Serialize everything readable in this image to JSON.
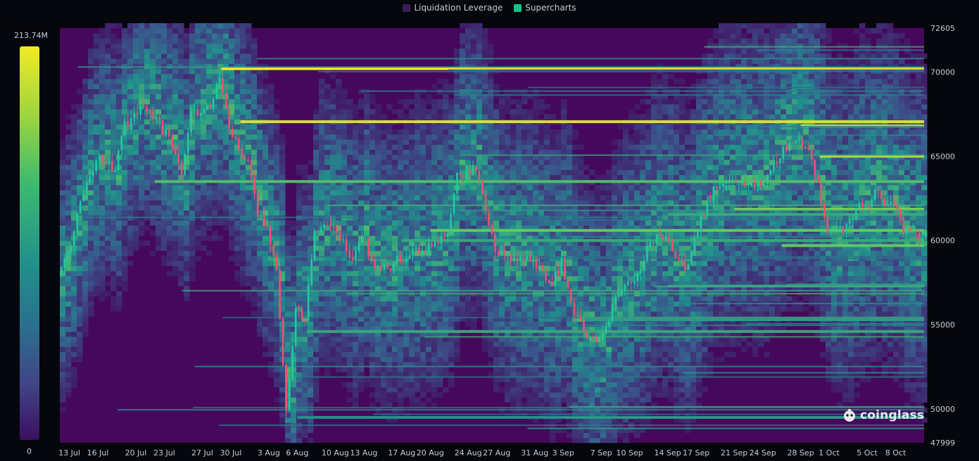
{
  "legend": {
    "items": [
      {
        "label": "Liquidation Leverage",
        "color": "#3a1c5a"
      },
      {
        "label": "Supercharts",
        "color": "#13c48a"
      }
    ]
  },
  "color_scale": {
    "max_label": "213.74M",
    "min_label": "0"
  },
  "watermark": {
    "text": "coinglass"
  },
  "chart_data": {
    "type": "heatmap",
    "title": "",
    "xlabel": "",
    "ylabel": "",
    "x_ticks": [
      "13 Jul",
      "16 Jul",
      "20 Jul",
      "23 Jul",
      "27 Jul",
      "30 Jul",
      "3 Aug",
      "6 Aug",
      "10 Aug",
      "13 Aug",
      "17 Aug",
      "20 Aug",
      "24 Aug",
      "27 Aug",
      "31 Aug",
      "3 Sep",
      "7 Sep",
      "10 Sep",
      "14 Sep",
      "17 Sep",
      "21 Sep",
      "24 Sep",
      "28 Sep",
      "1 Oct",
      "5 Oct",
      "8 Oct"
    ],
    "y_ticks": [
      72605,
      70000,
      65000,
      60000,
      55000,
      50000,
      47999
    ],
    "ylim": [
      47999,
      72605
    ],
    "xlim": [
      "12 Jul",
      "11 Oct"
    ],
    "color_range": [
      0,
      213740000
    ],
    "series_names": [
      "Liquidation Leverage",
      "Supercharts"
    ],
    "price_path": [
      [
        "12 Jul",
        57900
      ],
      [
        "13 Jul",
        59200
      ],
      [
        "15 Jul",
        63500
      ],
      [
        "16 Jul",
        64800
      ],
      [
        "18 Jul",
        64200
      ],
      [
        "19 Jul",
        66800
      ],
      [
        "21 Jul",
        68200
      ],
      [
        "22 Jul",
        67300
      ],
      [
        "24 Jul",
        65800
      ],
      [
        "25 Jul",
        64000
      ],
      [
        "26 Jul",
        67500
      ],
      [
        "28 Jul",
        68200
      ],
      [
        "29 Jul",
        69500
      ],
      [
        "30 Jul",
        66800
      ],
      [
        "31 Jul",
        65400
      ],
      [
        "1 Aug",
        64600
      ],
      [
        "2 Aug",
        61800
      ],
      [
        "3 Aug",
        60500
      ],
      [
        "4 Aug",
        58300
      ],
      [
        "5 Aug",
        50200
      ],
      [
        "6 Aug",
        56000
      ],
      [
        "7 Aug",
        55400
      ],
      [
        "8 Aug",
        60900
      ],
      [
        "9 Aug",
        60700
      ],
      [
        "10 Aug",
        60800
      ],
      [
        "12 Aug",
        58800
      ],
      [
        "13 Aug",
        60500
      ],
      [
        "14 Aug",
        58700
      ],
      [
        "16 Aug",
        58500
      ],
      [
        "18 Aug",
        59300
      ],
      [
        "20 Aug",
        59500
      ],
      [
        "22 Aug",
        60400
      ],
      [
        "23 Aug",
        64000
      ],
      [
        "24 Aug",
        64100
      ],
      [
        "25 Aug",
        64200
      ],
      [
        "27 Aug",
        59400
      ],
      [
        "28 Aug",
        59000
      ],
      [
        "30 Aug",
        59100
      ],
      [
        "31 Aug",
        58900
      ],
      [
        "2 Sep",
        57400
      ],
      [
        "3 Sep",
        58900
      ],
      [
        "4 Sep",
        56200
      ],
      [
        "6 Sep",
        54000
      ],
      [
        "7 Sep",
        53800
      ],
      [
        "9 Sep",
        57000
      ],
      [
        "10 Sep",
        57500
      ],
      [
        "11 Sep",
        58100
      ],
      [
        "13 Sep",
        60500
      ],
      [
        "14 Sep",
        60000
      ],
      [
        "16 Sep",
        58200
      ],
      [
        "17 Sep",
        60300
      ],
      [
        "19 Sep",
        63000
      ],
      [
        "20 Sep",
        63200
      ],
      [
        "22 Sep",
        63500
      ],
      [
        "24 Sep",
        63300
      ],
      [
        "26 Sep",
        65200
      ],
      [
        "27 Sep",
        65800
      ],
      [
        "28 Sep",
        65900
      ],
      [
        "29 Sep",
        65600
      ],
      [
        "30 Sep",
        63300
      ],
      [
        "1 Oct",
        60800
      ],
      [
        "2 Oct",
        60600
      ],
      [
        "3 Oct",
        60700
      ],
      [
        "4 Oct",
        62100
      ],
      [
        "5 Oct",
        62100
      ],
      [
        "6 Oct",
        62800
      ],
      [
        "7 Oct",
        62200
      ],
      [
        "8 Oct",
        62100
      ],
      [
        "9 Oct",
        60600
      ],
      [
        "10 Oct",
        60300
      ],
      [
        "11 Oct",
        60300
      ]
    ],
    "liquidation_levels": [
      {
        "price": 70200,
        "intensity": 1.0,
        "start": "29 Jul"
      },
      {
        "price": 67050,
        "intensity": 0.95,
        "start": "31 Jul"
      },
      {
        "price": 66800,
        "intensity": 0.9,
        "start": "28 Sep"
      },
      {
        "price": 65000,
        "intensity": 0.88,
        "start": "30 Sep"
      },
      {
        "price": 63500,
        "intensity": 0.7,
        "start": "22 Jul"
      },
      {
        "price": 61850,
        "intensity": 0.8,
        "start": "21 Sep"
      },
      {
        "price": 61550,
        "intensity": 0.6,
        "start": "14 Sep"
      },
      {
        "price": 60600,
        "intensity": 0.75,
        "start": "20 Aug"
      },
      {
        "price": 60000,
        "intensity": 0.6,
        "start": "17 Aug"
      },
      {
        "price": 59700,
        "intensity": 0.75,
        "start": "26 Sep"
      },
      {
        "price": 57300,
        "intensity": 0.55,
        "start": "14 Sep"
      },
      {
        "price": 55300,
        "intensity": 0.55,
        "start": "5 Sep"
      },
      {
        "price": 54600,
        "intensity": 0.6,
        "start": "7 Aug"
      },
      {
        "price": 49500,
        "intensity": 0.5,
        "start": "6 Aug"
      }
    ]
  }
}
